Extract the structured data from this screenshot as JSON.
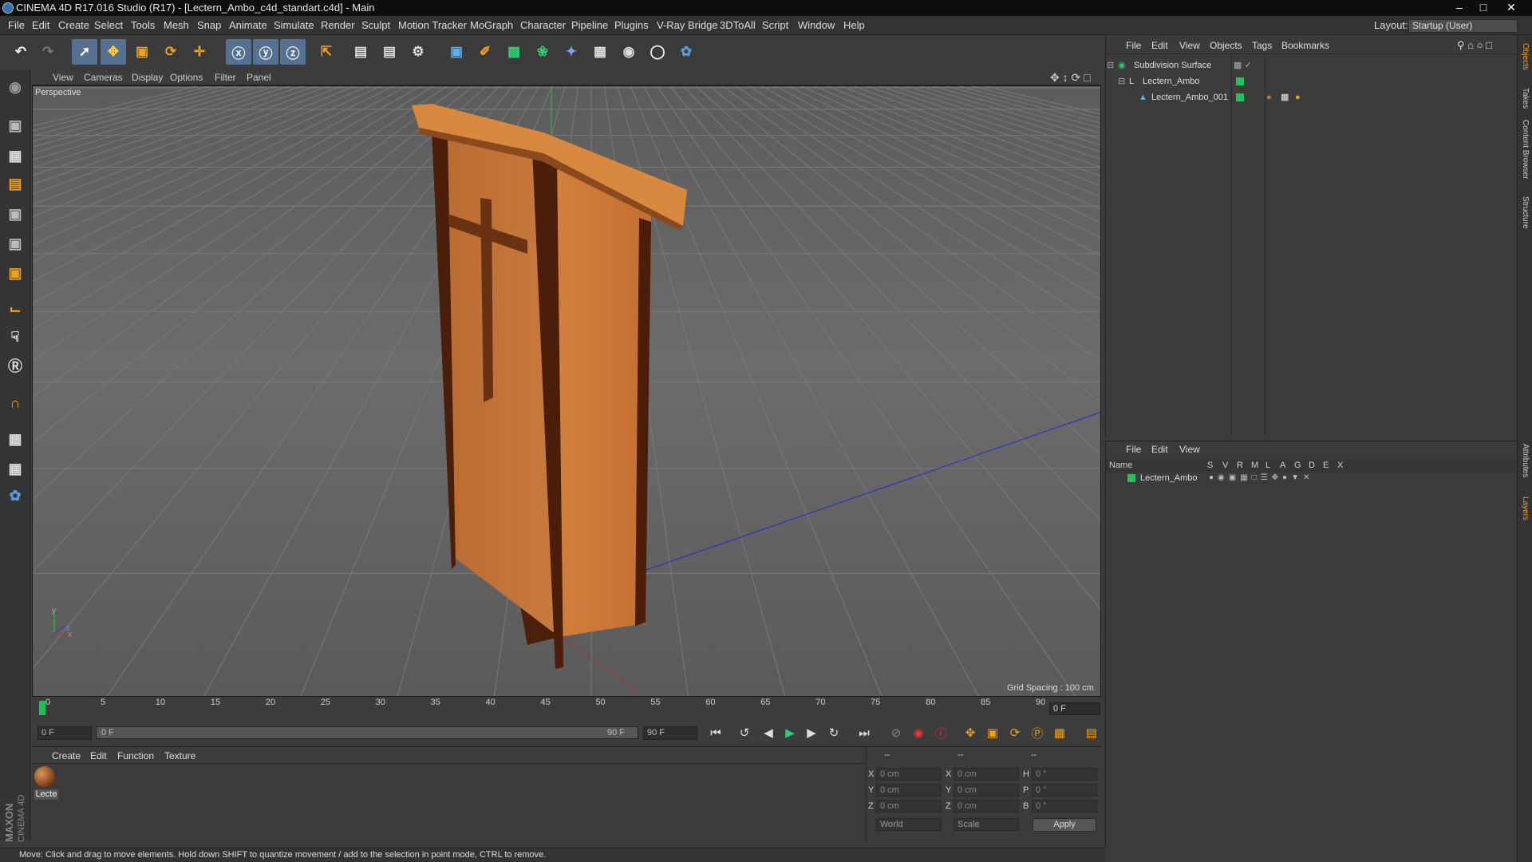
{
  "window": {
    "title": "CINEMA 4D R17.016 Studio (R17) - [Lectern_Ambo_c4d_standart.c4d] - Main"
  },
  "menubar": {
    "items": [
      "File",
      "Edit",
      "Create",
      "Select",
      "Tools",
      "Mesh",
      "Snap",
      "Animate",
      "Simulate",
      "Render",
      "Sculpt",
      "Motion Tracker",
      "MoGraph",
      "Character",
      "Pipeline",
      "Plugins",
      "V-Ray Bridge",
      "3DToAll",
      "Script",
      "Window",
      "Help"
    ],
    "layout_label": "Layout:",
    "layout_value": "Startup (User)"
  },
  "viewport": {
    "menu": [
      "View",
      "Cameras",
      "Display",
      "Options",
      "Filter",
      "Panel"
    ],
    "camera_label": "Perspective",
    "grid_spacing": "Grid Spacing : 100 cm",
    "axis_x": "x",
    "axis_y": "y",
    "axis_z": "z"
  },
  "timeline": {
    "ticks": [
      "0",
      "5",
      "10",
      "15",
      "20",
      "25",
      "30",
      "35",
      "40",
      "45",
      "50",
      "55",
      "60",
      "65",
      "70",
      "75",
      "80",
      "85",
      "90"
    ],
    "current_frame": "0 F",
    "start_frame": "0 F",
    "range_start": "0 F",
    "range_end": "90 F",
    "end_frame": "90 F"
  },
  "material_panel": {
    "menu": [
      "Create",
      "Edit",
      "Function",
      "Texture"
    ],
    "material_name": "Lecte"
  },
  "coords": {
    "header": [
      "--",
      "--",
      "--"
    ],
    "rows": [
      {
        "a": "X",
        "av": "0 cm",
        "b": "X",
        "bv": "0 cm",
        "c": "H",
        "cv": "0 °"
      },
      {
        "a": "Y",
        "av": "0 cm",
        "b": "Y",
        "bv": "0 cm",
        "c": "P",
        "cv": "0 °"
      },
      {
        "a": "Z",
        "av": "0 cm",
        "b": "Z",
        "bv": "0 cm",
        "c": "B",
        "cv": "0 °"
      }
    ],
    "space": "World",
    "mode": "Scale",
    "apply": "Apply"
  },
  "status": "Move: Click and drag to move elements. Hold down SHIFT to quantize movement / add to the selection in point mode, CTRL to remove.",
  "objects": {
    "menu": [
      "File",
      "Edit",
      "View",
      "Objects",
      "Tags",
      "Bookmarks"
    ],
    "rows": [
      "Subdivision Surface",
      "Lectern_Ambo",
      "Lectern_Ambo_001"
    ]
  },
  "layers": {
    "menu": [
      "File",
      "Edit",
      "View"
    ],
    "columns": [
      "Name",
      "S",
      "V",
      "R",
      "M",
      "L",
      "A",
      "G",
      "D",
      "E",
      "X"
    ],
    "rows": [
      "Lectern_Ambo"
    ]
  },
  "side_tabs": [
    "Objects",
    "Takes",
    "Content Browser",
    "Structure",
    "Attributes",
    "Layers"
  ],
  "brand": {
    "line1": "MAXON",
    "line2": "CINEMA 4D"
  },
  "colors": {
    "wood": "#c8743a",
    "wood_dark": "#5a2a10",
    "grid_bg": "#6b6b6b",
    "accent_green": "#22c35a"
  }
}
